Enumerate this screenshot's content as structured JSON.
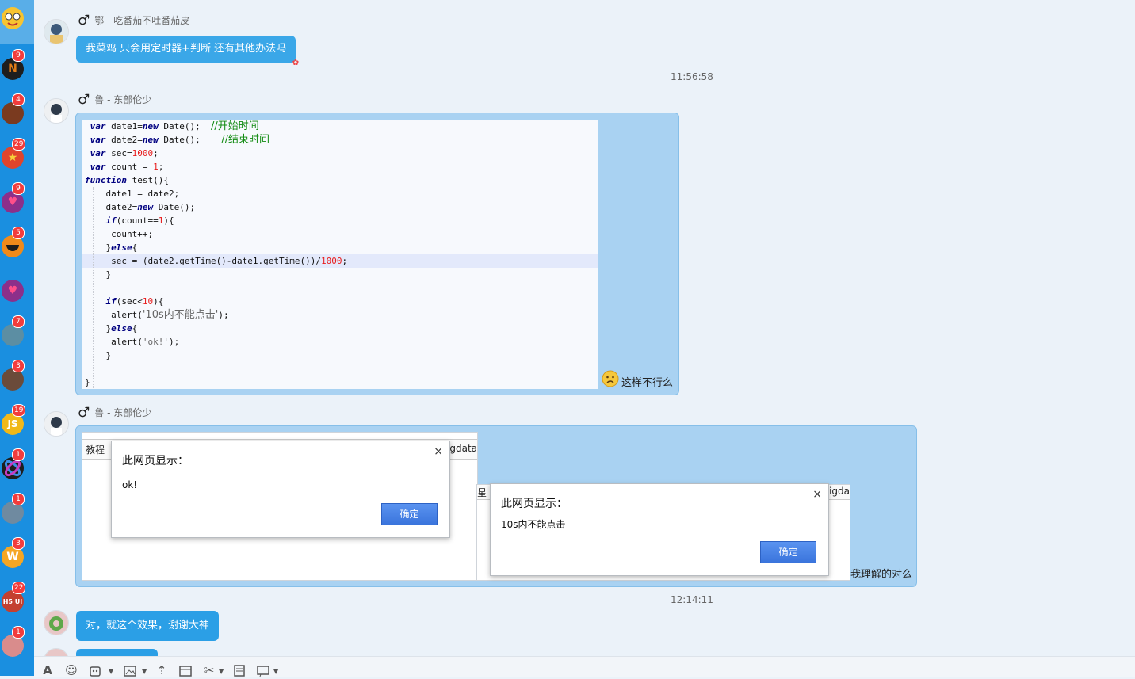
{
  "sidebar": {
    "items": [
      {
        "label": "",
        "badge": "",
        "color": "#f7c431"
      },
      {
        "label": "N",
        "badge": "9",
        "color": "#e07b17"
      },
      {
        "label": "",
        "badge": "4",
        "color": "#7a3a1f"
      },
      {
        "label": "",
        "badge": "29",
        "color": "#e0442c"
      },
      {
        "label": "",
        "badge": "9",
        "color": "#8c2f8a"
      },
      {
        "label": "",
        "badge": "5",
        "color": "#f08a1a"
      },
      {
        "label": "",
        "badge": "",
        "color": "#8c2f8a"
      },
      {
        "label": "",
        "badge": "7",
        "color": "#5c8ea3"
      },
      {
        "label": "",
        "badge": "3",
        "color": "#6b4b3a"
      },
      {
        "label": "JS",
        "badge": "19",
        "color": "#f0b818"
      },
      {
        "label": "",
        "badge": "1",
        "color": "#3a56a8"
      },
      {
        "label": "",
        "badge": "1",
        "color": "#6f8aa0"
      },
      {
        "label": "W",
        "badge": "3",
        "color": "#f5a623"
      },
      {
        "label": "H5 UI",
        "badge": "22",
        "color": "#c4402f"
      },
      {
        "label": "",
        "badge": "1",
        "color": "#d98c8c"
      }
    ]
  },
  "messages": {
    "m1": {
      "sender": "鄂 - 吃番茄不吐番茄皮",
      "gender": "♂",
      "text": "我菜鸡 只会用定时器+判断   还有其他办法吗"
    },
    "ts1": "11:56:58",
    "m2": {
      "sender": "鲁 - 东部伦少",
      "gender": "♂",
      "caption": "这样不行么",
      "code": {
        "l1a": " var",
        "l1b": " date1=",
        "l1c": "new",
        "l1d": " Date();  ",
        "l1e": "//开始时间",
        "l2a": " var",
        "l2b": " date2=",
        "l2c": "new",
        "l2d": " Date();    ",
        "l2e": "//结束时间",
        "l3a": " var",
        "l3b": " sec=",
        "l3c": "1000",
        "l3d": ";",
        "l4a": " var",
        "l4b": " count = ",
        "l4c": "1",
        "l4d": ";",
        "l5a": "function",
        "l5b": " test(){",
        "l6": "    date1 = date2;",
        "l7a": "    date2=",
        "l7b": "new",
        "l7c": " Date();",
        "l8a": "    ",
        "l8b": "if",
        "l8c": "(count==",
        "l8d": "1",
        "l8e": "){",
        "l9": "     count++;",
        "l10a": "    }",
        "l10b": "else",
        "l10c": "{",
        "l11a": "     sec = (date2.getTime()-date1.getTime())/",
        "l11b": "1000",
        "l11c": ";",
        "l12": "    }",
        "l14a": "    ",
        "l14b": "if",
        "l14c": "(sec<",
        "l14d": "10",
        "l14e": "){",
        "l15a": "     alert(",
        "l15b": "'10s内不能点击'",
        "l15c": ");",
        "l16a": "    }",
        "l16b": "else",
        "l16c": "{",
        "l17a": "     alert(",
        "l17b": "'ok!'",
        "l17c": ");",
        "l18": "    }",
        "l20": "}"
      }
    },
    "m3": {
      "sender": "鲁 - 东部伦少",
      "gender": "♂",
      "caption": "我理解的对么",
      "shot_left_tab": "教程",
      "shot_left_tab2": "igdata",
      "shot_right_tab": "星",
      "shot_right_tab2": "igda",
      "dialog1": {
        "title": "此网页显示：",
        "message": "ok!",
        "button": "确定",
        "close": "×"
      },
      "dialog2": {
        "title": "此网页显示：",
        "message": "10s内不能点击",
        "button": "确定",
        "close": "×"
      }
    },
    "ts2": "12:14:11",
    "m4": {
      "text": "对，就这个效果，谢谢大神"
    }
  },
  "toolbar": {
    "icons": [
      "font-icon",
      "emoji-icon",
      "sticker-icon",
      "image-icon",
      "upload-icon",
      "calendar-icon",
      "scissors-icon",
      "history-icon",
      "more-icon"
    ]
  }
}
